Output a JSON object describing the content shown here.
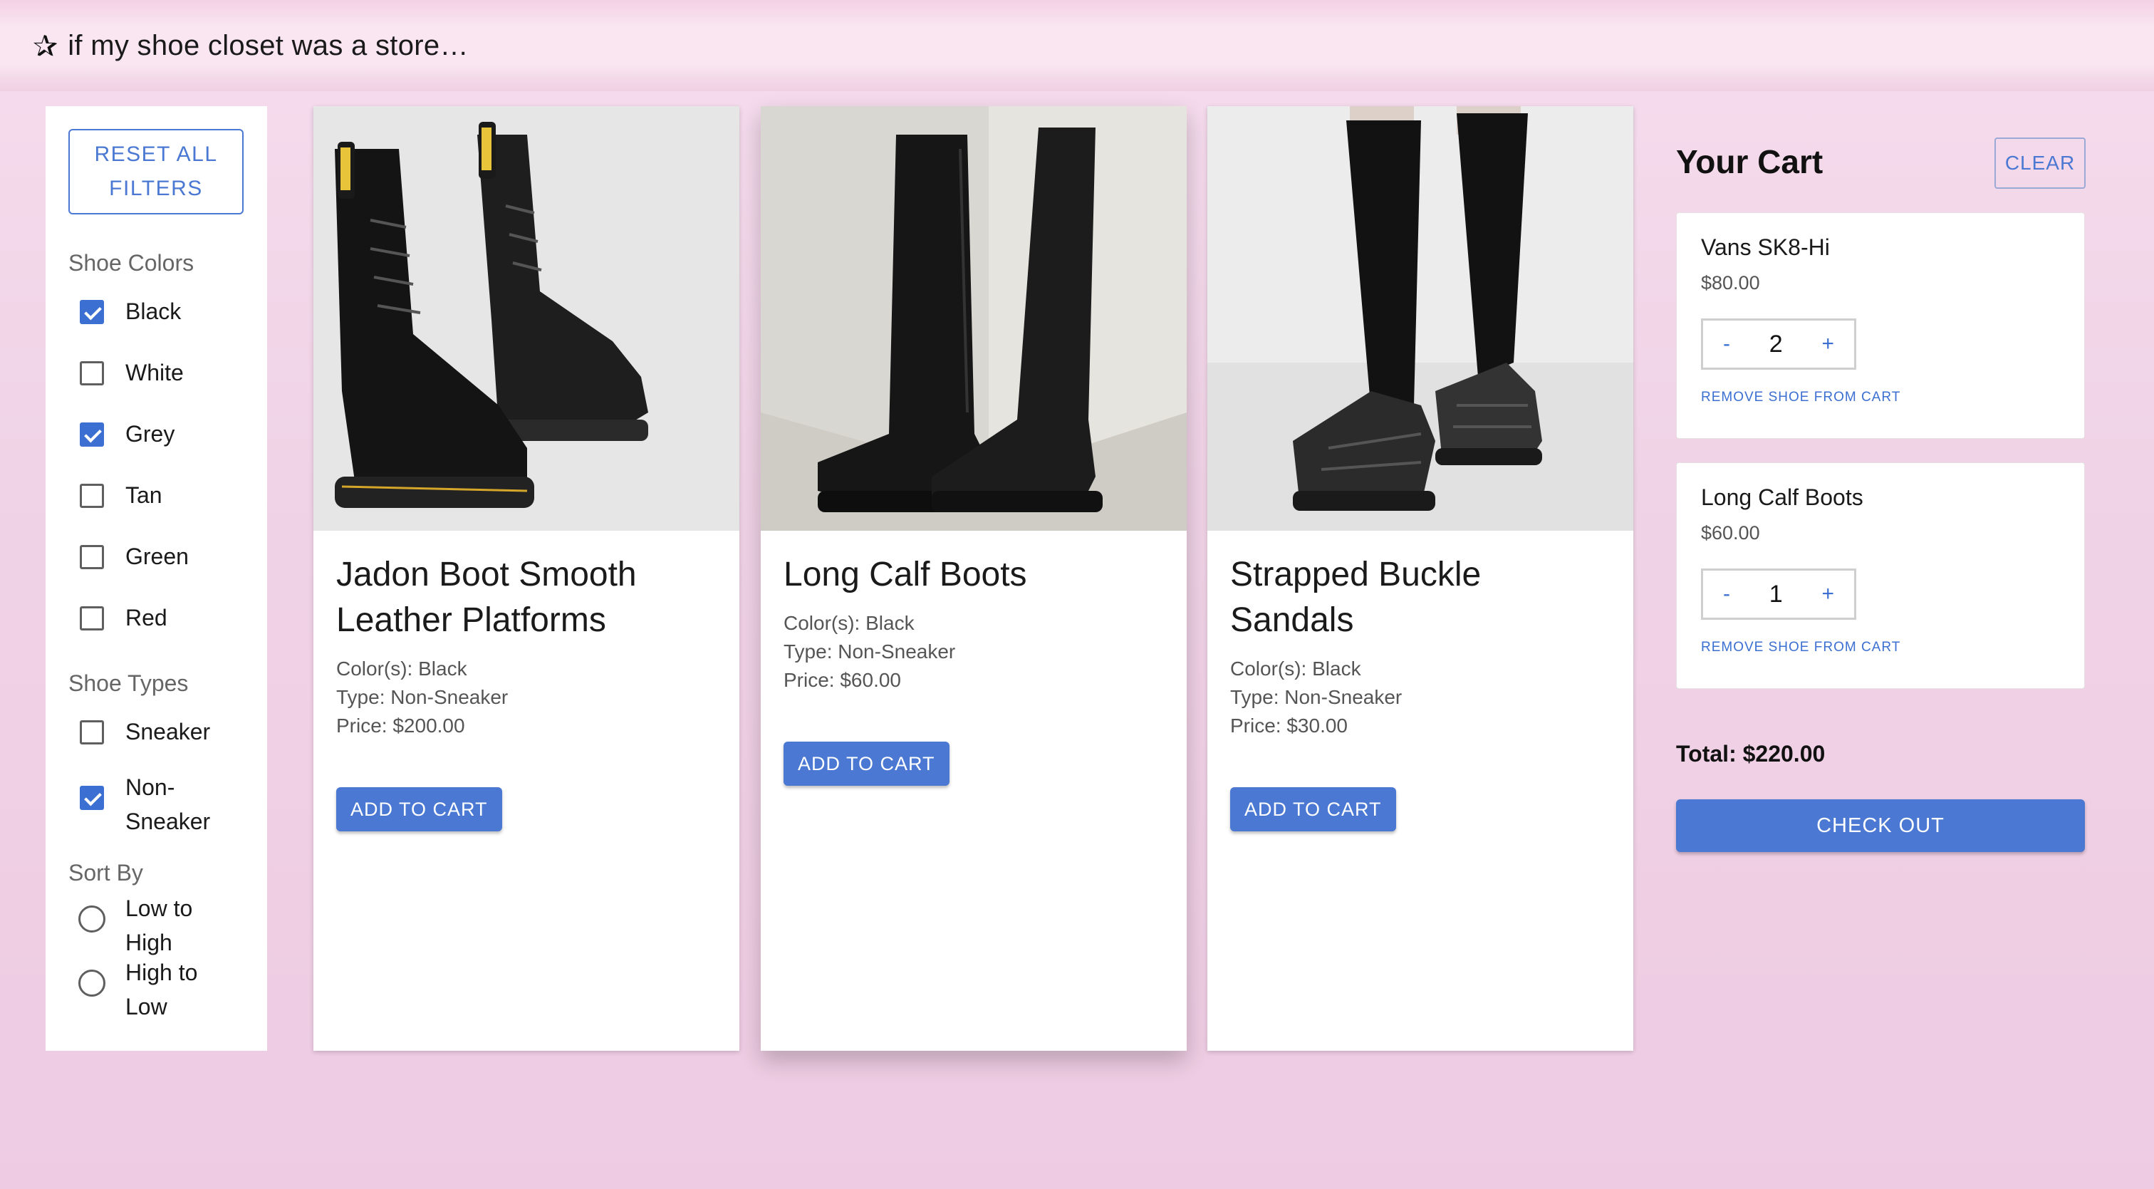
{
  "header": {
    "star_icon": "✰",
    "title": "if my shoe closet was a store…"
  },
  "filters": {
    "reset_label": "RESET ALL FILTERS",
    "colors_heading": "Shoe Colors",
    "colors": [
      {
        "label": "Black",
        "checked": true
      },
      {
        "label": "White",
        "checked": false
      },
      {
        "label": "Grey",
        "checked": true
      },
      {
        "label": "Tan",
        "checked": false
      },
      {
        "label": "Green",
        "checked": false
      },
      {
        "label": "Red",
        "checked": false
      }
    ],
    "types_heading": "Shoe Types",
    "types": [
      {
        "label": "Sneaker",
        "checked": false
      },
      {
        "label": "Non-Sneaker",
        "checked": true
      }
    ],
    "sort_heading": "Sort By",
    "sort": [
      {
        "label": "Low to High",
        "selected": false
      },
      {
        "label": "High to Low",
        "selected": false
      }
    ]
  },
  "products": [
    {
      "name": "Jadon Boot Smooth Leather Platforms",
      "colors": "Color(s): Black",
      "type": "Type: Non-Sneaker",
      "price": "Price: $200.00",
      "button": "ADD TO CART",
      "image": "black lace-up platform boots"
    },
    {
      "name": "Long Calf Boots",
      "colors": "Color(s): Black",
      "type": "Type: Non-Sneaker",
      "price": "Price: $60.00",
      "button": "ADD TO CART",
      "image": "black knee-high boots"
    },
    {
      "name": "Strapped Buckle Sandals",
      "colors": "Color(s): Black",
      "type": "Type: Non-Sneaker",
      "price": "Price: $30.00",
      "button": "ADD TO CART",
      "image": "black strapped sandals with socks"
    }
  ],
  "cart": {
    "title": "Your Cart",
    "clear_label": "CLEAR",
    "items": [
      {
        "name": "Vans SK8-Hi",
        "price": "$80.00",
        "qty": "2",
        "minus": "-",
        "plus": "+",
        "remove": "REMOVE SHOE FROM CART"
      },
      {
        "name": "Long Calf Boots",
        "price": "$60.00",
        "qty": "1",
        "minus": "-",
        "plus": "+",
        "remove": "REMOVE SHOE FROM CART"
      }
    ],
    "total": "Total: $220.00",
    "checkout_label": "CHECK OUT"
  },
  "colors": {
    "accent": "#4a78d2",
    "checkbox": "#3b6fd1",
    "background": "#f0d3e6"
  }
}
